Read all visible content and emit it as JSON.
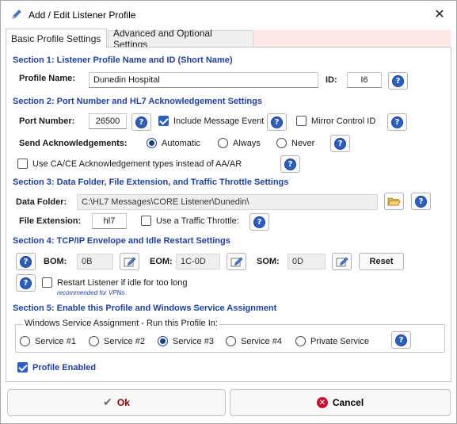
{
  "window": {
    "title": "Add / Edit Listener Profile",
    "close_glyph": "✕"
  },
  "tabs": [
    {
      "label": "Basic Profile Settings",
      "active": true
    },
    {
      "label": "Advanced and Optional Settings",
      "active": false
    }
  ],
  "section1": {
    "title": "Section 1: Listener Profile Name and ID (Short Name)",
    "profile_name_label": "Profile Name:",
    "profile_name_value": "Dunedin Hospital",
    "id_label": "ID:",
    "id_value": "I6"
  },
  "section2": {
    "title": "Section 2: Port  Number and HL7 Acknowledgement Settings",
    "port_label": "Port Number:",
    "port_value": "26500",
    "include_message_event": {
      "label": "Include Message Event",
      "checked": true
    },
    "mirror_control_id": {
      "label": "Mirror Control ID",
      "checked": false
    },
    "send_ack_label": "Send Acknowledgements:",
    "ack_options": [
      {
        "label": "Automatic",
        "selected": true
      },
      {
        "label": "Always",
        "selected": false
      },
      {
        "label": "Never",
        "selected": false
      }
    ],
    "use_ca_ce": {
      "label": "Use CA/CE Acknowledgement types instead of AA/AR",
      "checked": false
    }
  },
  "section3": {
    "title": "Section 3: Data Folder, File Extension, and Traffic Throttle Settings",
    "data_folder_label": "Data Folder:",
    "data_folder_value": "C:\\HL7 Messages\\CORE Listener\\Dunedin\\",
    "file_ext_label": "File Extension:",
    "file_ext_value": "hl7",
    "traffic_throttle": {
      "label": "Use a Traffic Throttle:",
      "checked": false
    }
  },
  "section4": {
    "title": "Section 4: TCP/IP  Envelope and Idle Restart Settings",
    "bom_label": "BOM:",
    "bom_value": "0B",
    "eom_label": "EOM:",
    "eom_value": "1C-0D",
    "som_label": "SOM:",
    "som_value": "0D",
    "reset_label": "Reset",
    "restart_idle": {
      "label": "Restart Listener if idle for too long",
      "checked": false
    },
    "recommended_note": "recommended for VPNs"
  },
  "section5": {
    "title": "Section 5: Enable  this Profile and Windows Service Assignment",
    "group_title": "Windows Service Assignment - Run this Profile In:",
    "services": [
      {
        "label": "Service #1",
        "selected": false
      },
      {
        "label": "Service #2",
        "selected": false
      },
      {
        "label": "Service #3",
        "selected": true
      },
      {
        "label": "Service #4",
        "selected": false
      },
      {
        "label": "Private Service",
        "selected": false
      }
    ],
    "profile_enabled": {
      "label": "Profile Enabled",
      "checked": true
    }
  },
  "footer": {
    "ok_label": "Ok",
    "cancel_label": "Cancel"
  },
  "icons": {
    "help": "?",
    "accent": "#2a5fc1",
    "section_color": "#1f3fa6"
  }
}
